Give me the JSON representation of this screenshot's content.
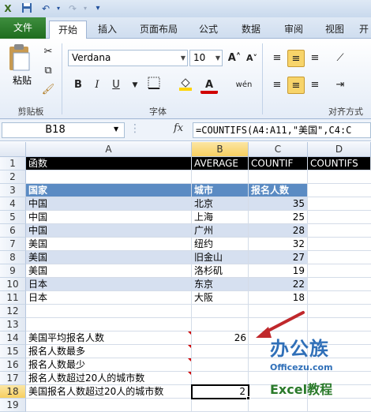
{
  "qat": {
    "save_icon": "save-icon",
    "undo_icon": "undo-icon",
    "redo_icon": "redo-icon"
  },
  "tabs": [
    {
      "label": "文件"
    },
    {
      "label": "开始"
    },
    {
      "label": "插入"
    },
    {
      "label": "页面布局"
    },
    {
      "label": "公式"
    },
    {
      "label": "数据"
    },
    {
      "label": "审阅"
    },
    {
      "label": "视图"
    },
    {
      "label": "开"
    }
  ],
  "ribbon": {
    "paste_label": "粘贴",
    "clipboard_label": "剪贴板",
    "font_group_label": "字体",
    "align_group_label": "对齐方式",
    "font_name": "Verdana",
    "font_size": "10",
    "grow_font": "A˄",
    "shrink_font": "A˅",
    "bold": "B",
    "italic": "I",
    "underline": "U",
    "fill_icon": "fill-color-icon",
    "font_color_glyph": "A",
    "wen": "wén"
  },
  "formula_bar": {
    "name_box": "B18",
    "fx": "fx",
    "formula": "=COUNTIFS(A4:A11,\"美国\",C4:C"
  },
  "columns": [
    "A",
    "B",
    "C",
    "D"
  ],
  "rows": [
    "1",
    "2",
    "3",
    "4",
    "5",
    "6",
    "7",
    "8",
    "9",
    "10",
    "11",
    "12",
    "13",
    "14",
    "15",
    "16",
    "17",
    "18",
    "19"
  ],
  "sheet": {
    "r1": {
      "a": "函数",
      "b": "AVERAGE",
      "c": "COUNTIF",
      "d": "COUNTIFS"
    },
    "r3": {
      "a": "国家",
      "b": "城市",
      "c": "报名人数"
    },
    "data": [
      {
        "country": "中国",
        "city": "北京",
        "count": "35"
      },
      {
        "country": "中国",
        "city": "上海",
        "count": "25"
      },
      {
        "country": "中国",
        "city": "广州",
        "count": "28"
      },
      {
        "country": "美国",
        "city": "纽约",
        "count": "32"
      },
      {
        "country": "美国",
        "city": "旧金山",
        "count": "27"
      },
      {
        "country": "美国",
        "city": "洛杉矶",
        "count": "19"
      },
      {
        "country": "日本",
        "city": "东京",
        "count": "22"
      },
      {
        "country": "日本",
        "city": "大阪",
        "count": "18"
      }
    ],
    "r14": {
      "a": "美国平均报名人数",
      "b": "26"
    },
    "r15": {
      "a": "报名人数最多"
    },
    "r16": {
      "a": "报名人数最少"
    },
    "r17": {
      "a": "报名人数超过20人的城市数"
    },
    "r18": {
      "a": "美国报名人数超过20人的城市数",
      "b": "2"
    }
  },
  "watermark": {
    "logo_text": "办公族",
    "domain": "Officezu.com",
    "subtitle": "Excel教程"
  },
  "colors": {
    "accent_red": "#c0282c",
    "file_tab": "#2a7a2a",
    "header_blue": "#5b8bc3",
    "band": "#d6e0f0"
  }
}
